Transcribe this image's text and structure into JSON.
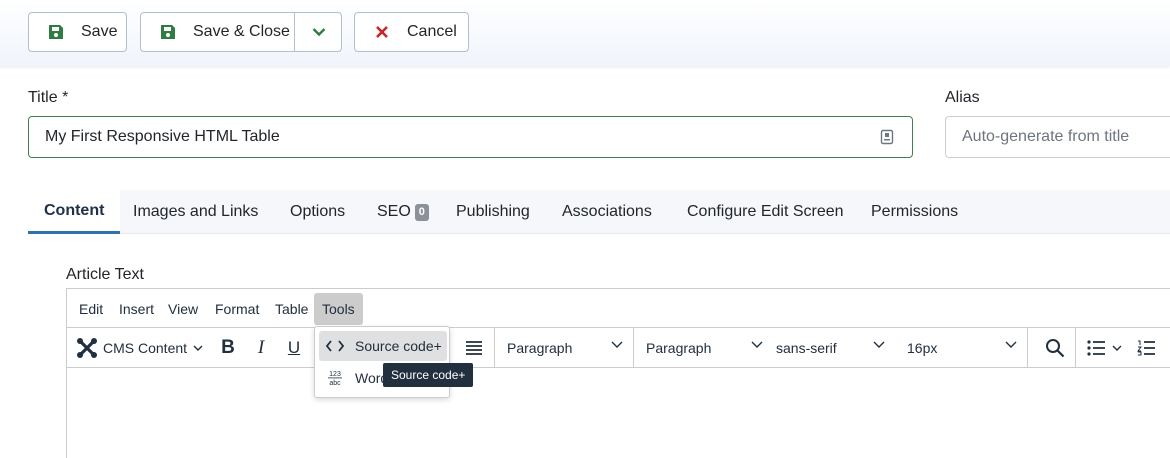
{
  "toolbar": {
    "save_label": "Save",
    "save_close_label": "Save & Close",
    "cancel_label": "Cancel"
  },
  "form": {
    "title_label": "Title *",
    "title_value": "My First Responsive HTML Table",
    "alias_label": "Alias",
    "alias_placeholder": "Auto-generate from title"
  },
  "tabs": [
    {
      "label": "Content",
      "active": true
    },
    {
      "label": "Images and Links"
    },
    {
      "label": "Options"
    },
    {
      "label": "SEO",
      "badge": "0"
    },
    {
      "label": "Publishing"
    },
    {
      "label": "Associations"
    },
    {
      "label": "Configure Edit Screen"
    },
    {
      "label": "Permissions"
    }
  ],
  "editor": {
    "label": "Article Text",
    "menu": [
      "Edit",
      "Insert",
      "View",
      "Format",
      "Table",
      "Tools"
    ],
    "cms_content": "CMS Content",
    "block_format_1": "Paragraph",
    "block_format_2": "Paragraph",
    "font_family": "sans-serif",
    "font_size": "16px"
  },
  "tools_menu": {
    "items": [
      "Source code+",
      "Word"
    ],
    "tooltip": "Source code+"
  },
  "colors": {
    "save_icon": "#2f7d45",
    "cancel_icon": "#c52827",
    "tab_active": "#3071a9",
    "title_border": "#457d54"
  }
}
